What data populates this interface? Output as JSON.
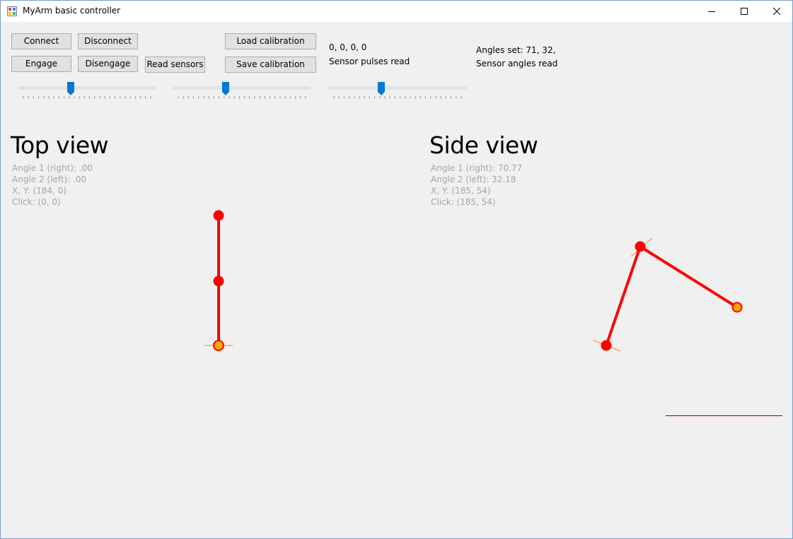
{
  "window": {
    "title": "MyArm basic controller"
  },
  "toolbar": {
    "connect_label": "Connect",
    "disconnect_label": "Disconnect",
    "engage_label": "Engage",
    "disengage_label": "Disengage",
    "read_sensors_label": "Read sensors",
    "load_calibration_label": "Load calibration",
    "save_calibration_label": "Save calibration"
  },
  "status": {
    "sensor_pulses_values": "0, 0, 0, 0",
    "sensor_pulses_caption": "Sensor pulses read",
    "angles_set": "Angles set: 71, 32,",
    "sensor_angles_caption": "Sensor angles read"
  },
  "sliders": [
    {
      "name": "slider-1",
      "value_fraction": 0.38
    },
    {
      "name": "slider-2",
      "value_fraction": 0.38
    },
    {
      "name": "slider-3",
      "value_fraction": 0.38
    }
  ],
  "top_view": {
    "title": "Top view",
    "angle1": "Angle 1 (right): .00",
    "angle2": "Angle 2 (left): .00",
    "xy": "X, Y: (184, 0)",
    "click": "Click: (0, 0)"
  },
  "side_view": {
    "title": "Side view",
    "angle1": "Angle 1 (right): 70.77",
    "angle2": "Angle 2 (left): 32.18",
    "xy": "X, Y: (185, 54)",
    "click": "Click: (185, 54)"
  },
  "colors": {
    "arm": "#ff0000",
    "joint": "#ff0000",
    "end_effector": "#ffa500",
    "marker": "#ff8c00",
    "baseline": "#8b0000",
    "slider_thumb": "#0078d7"
  }
}
